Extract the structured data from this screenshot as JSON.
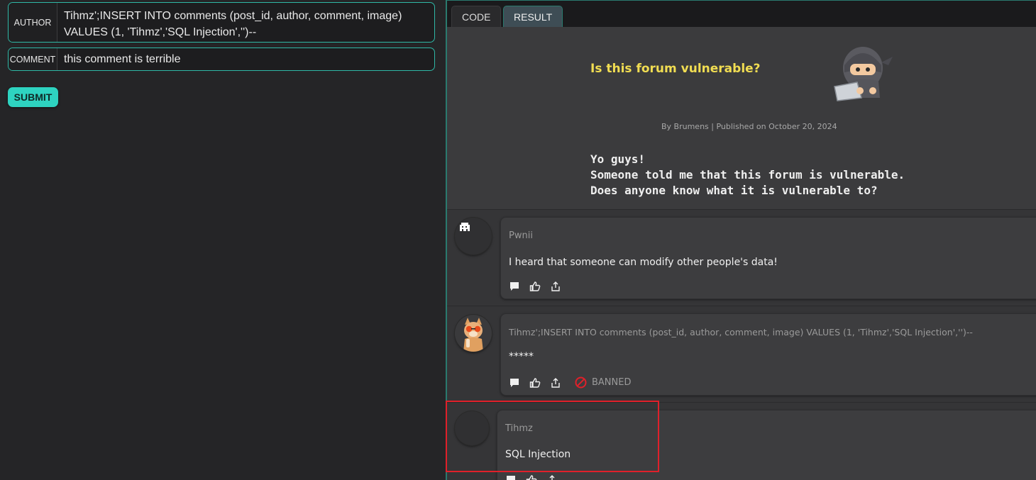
{
  "form": {
    "author_label": "AUTHOR",
    "author_value": "Tihmz';INSERT INTO comments (post_id, author, comment, image) VALUES (1, 'Tihmz','SQL Injection','')--",
    "comment_label": "COMMENT",
    "comment_value": "this comment is terrible",
    "submit_label": "SUBMIT"
  },
  "tabs": [
    {
      "label": "CODE",
      "active": false
    },
    {
      "label": "RESULT",
      "active": true
    }
  ],
  "post": {
    "title": "Is this forum vulnerable?",
    "byline": "By Brumens | Published on October 20, 2024",
    "body": [
      "Yo guys!",
      "Someone told me that this forum is vulnerable.",
      "Does anyone know what it is vulnerable to?"
    ],
    "mascot_icon": "ninja-laptop-icon"
  },
  "comments": [
    {
      "author": "Pwnii",
      "text": "I heard that someone can modify other people's data!",
      "avatar_icon": "pixel-ghost-avatar",
      "banned": false
    },
    {
      "author": "Tihmz';INSERT INTO comments (post_id, author, comment, image) VALUES (1, 'Tihmz','SQL Injection','')--",
      "text": "*****",
      "avatar_icon": "cat-sunglasses-avatar",
      "banned": true,
      "banned_label": "BANNED"
    },
    {
      "author": "Tihmz",
      "text": "SQL Injection",
      "avatar_icon": "empty-avatar",
      "banned": false
    }
  ],
  "colors": {
    "accent": "#2ed3c0",
    "title": "#f1dd52",
    "banned_icon": "#e0202a",
    "highlight": "#e0202a"
  }
}
